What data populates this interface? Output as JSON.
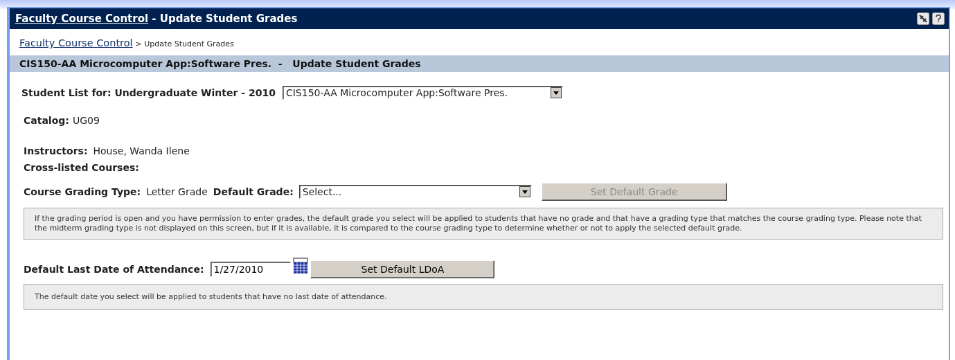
{
  "window": {
    "title_link": "Faculty Course Control",
    "title_rest": " - Update Student Grades"
  },
  "breadcrumb": {
    "link": "Faculty Course Control",
    "current": "> Update Student Grades"
  },
  "section_header": "CIS150-AA Microcomputer App:Software Pres.  -   Update Student Grades",
  "student_list": {
    "label": "Student List for: Undergraduate Winter - 2010",
    "course_value": "CIS150-AA Microcomputer App:Software Pres."
  },
  "catalog": {
    "label": "Catalog:",
    "value": "UG09"
  },
  "instructors": {
    "label": "Instructors:",
    "value": "House, Wanda Ilene"
  },
  "cross_listed": {
    "label": "Cross-listed Courses:"
  },
  "grading": {
    "label": "Course Grading Type:",
    "value": "Letter Grade",
    "default_label": "Default Grade:",
    "default_value": "Select...",
    "button": {
      "label": "Set Default Grade",
      "disabled": true
    }
  },
  "grade_note": "If the grading period is open and you have permission to enter grades, the default grade you select will be applied to students that have no grade and that have a grading type that matches the course grading type. Please note that the midterm grading type is not displayed on this screen, but if it is available, it is compared to the course grading type to determine whether or not to apply the selected default grade.",
  "ldoa": {
    "label": "Default Last Date of Attendance:",
    "value": "1/27/2010",
    "button": {
      "label": "Set Default LDoA",
      "disabled": false
    }
  },
  "ldoa_note": "The default date you select will be applied to students that have no last date of attendance."
}
